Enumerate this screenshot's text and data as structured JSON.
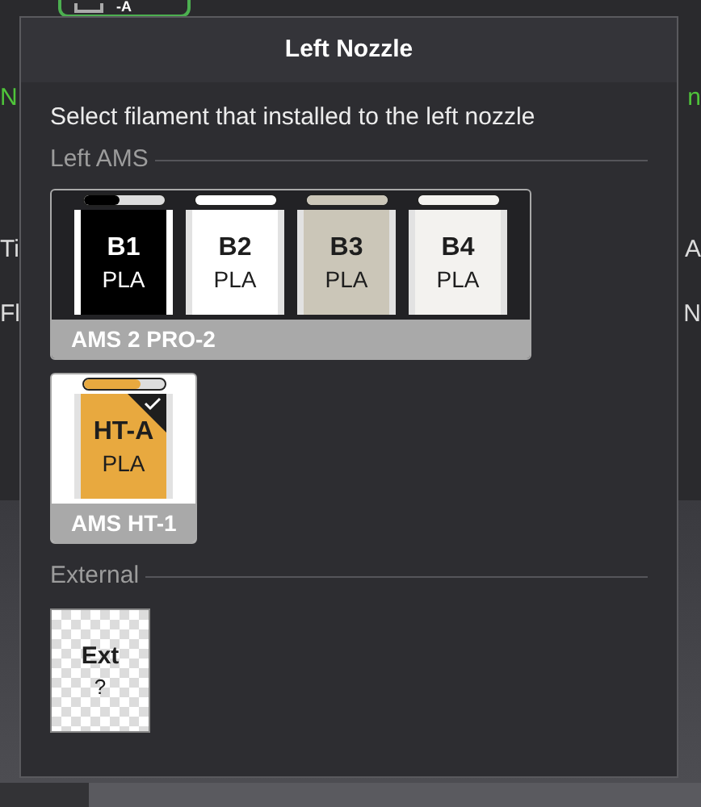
{
  "background": {
    "top_button": {
      "label": "-A"
    },
    "left_texts": [
      {
        "text": "N",
        "kind": "status"
      },
      {
        "text": "Ti",
        "kind": "plain"
      },
      {
        "text": "Fl",
        "kind": "plain"
      }
    ],
    "right_texts": [
      {
        "text": "n",
        "kind": "status"
      },
      {
        "text": "A",
        "kind": "plain"
      },
      {
        "text": "N",
        "kind": "plain"
      }
    ]
  },
  "dialog": {
    "title": "Left Nozzle",
    "instruction": "Select filament that installed to the left nozzle",
    "sections": [
      {
        "title": "Left AMS",
        "groups": [
          {
            "name": "AMS 2 PRO-2",
            "slots": [
              {
                "label": "B1",
                "material": "PLA",
                "color": "#000000",
                "level": 0.45,
                "selected": false
              },
              {
                "label": "B2",
                "material": "PLA",
                "color": "#ffffff",
                "level": 1,
                "selected": false
              },
              {
                "label": "B3",
                "material": "PLA",
                "color": "#cbc6b8",
                "level": 1,
                "selected": false
              },
              {
                "label": "B4",
                "material": "PLA",
                "color": "#f3f2ef",
                "level": 1,
                "selected": false
              }
            ]
          },
          {
            "name": "AMS HT-1",
            "slots": [
              {
                "label": "HT-A",
                "material": "PLA",
                "color": "#e8a93f",
                "level": 0.7,
                "selected": true
              }
            ]
          }
        ]
      },
      {
        "title": "External",
        "external": [
          {
            "label": "Ext",
            "material": "?",
            "selected": false
          }
        ]
      }
    ]
  }
}
